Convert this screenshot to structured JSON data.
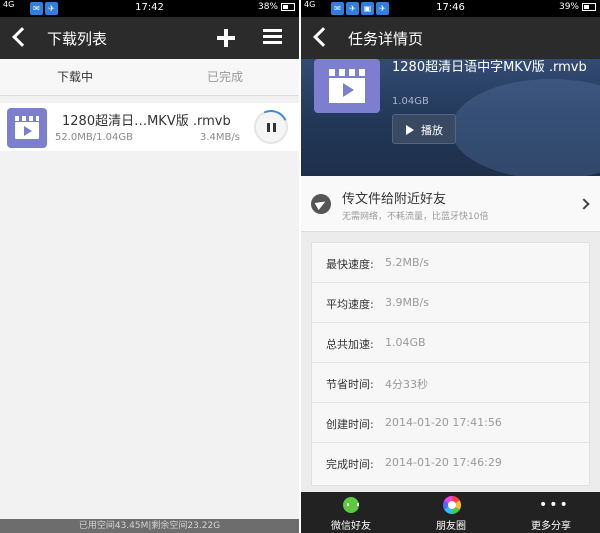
{
  "left": {
    "status": {
      "time": "17:42",
      "signal": "4G",
      "battery": "38%"
    },
    "header": {
      "title": "下载列表"
    },
    "tabs": [
      {
        "label": "下载中"
      },
      {
        "label": "已完成"
      }
    ],
    "downloads": [
      {
        "name": "1280超清日…MKV版 .rmvb",
        "size": "52.0MB/1.04GB",
        "speed": "3.4MB/s",
        "progress": 0.05
      }
    ],
    "footer": {
      "storage": "已用空间43.45M|剩余空间23.22G"
    }
  },
  "right": {
    "status": {
      "time": "17:46",
      "signal": "4G",
      "battery": "39%"
    },
    "header": {
      "title": "任务详情页"
    },
    "file": {
      "name": "1280超清日语中字MKV版 .rmvb",
      "size": "1.04GB",
      "play_label": "播放"
    },
    "share": {
      "title": "传文件给附近好友",
      "subtitle": "无需网络，不耗流量，比蓝牙快10倍"
    },
    "details": [
      {
        "label": "最快速度:",
        "value": "5.2MB/s"
      },
      {
        "label": "平均速度:",
        "value": "3.9MB/s"
      },
      {
        "label": "总共加速:",
        "value": "1.04GB"
      },
      {
        "label": "节省时间:",
        "value": "4分33秒"
      },
      {
        "label": "创建时间:",
        "value": "2014-01-20 17:41:56"
      },
      {
        "label": "完成时间:",
        "value": "2014-01-20 17:46:29"
      }
    ],
    "bottom": [
      {
        "label": "微信好友",
        "icon": "wechat-icon"
      },
      {
        "label": "朋友圈",
        "icon": "moments-icon"
      },
      {
        "label": "更多分享",
        "icon": "more-dots-icon"
      }
    ]
  }
}
